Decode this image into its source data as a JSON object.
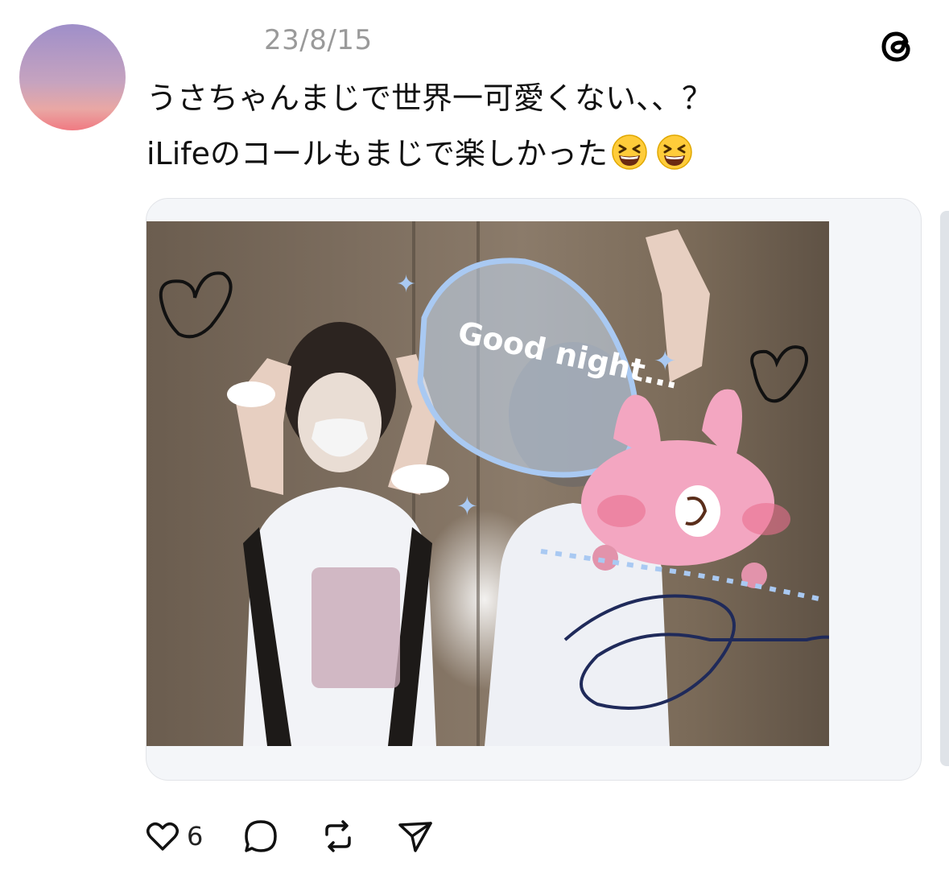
{
  "post": {
    "timestamp": "23/8/15",
    "text_line1": "うさちゃんまじで世界一可愛くない、、？",
    "text_line2": "iLifeのコールもまじで楽しかった",
    "emojis": [
      "grinning-squinting-face",
      "grinning-squinting-face"
    ],
    "image_caption": "Good night..."
  },
  "actions": {
    "like_count": "6",
    "icons": [
      "heart-icon",
      "comment-icon",
      "repost-icon",
      "share-icon"
    ]
  },
  "colors": {
    "avatar_top": "#9f8fc9",
    "avatar_bottom": "#f07a82",
    "timestamp": "#9a9a9a",
    "sticker_blue": "#a9c9f2",
    "sticker_pink": "#f3a6c1"
  }
}
